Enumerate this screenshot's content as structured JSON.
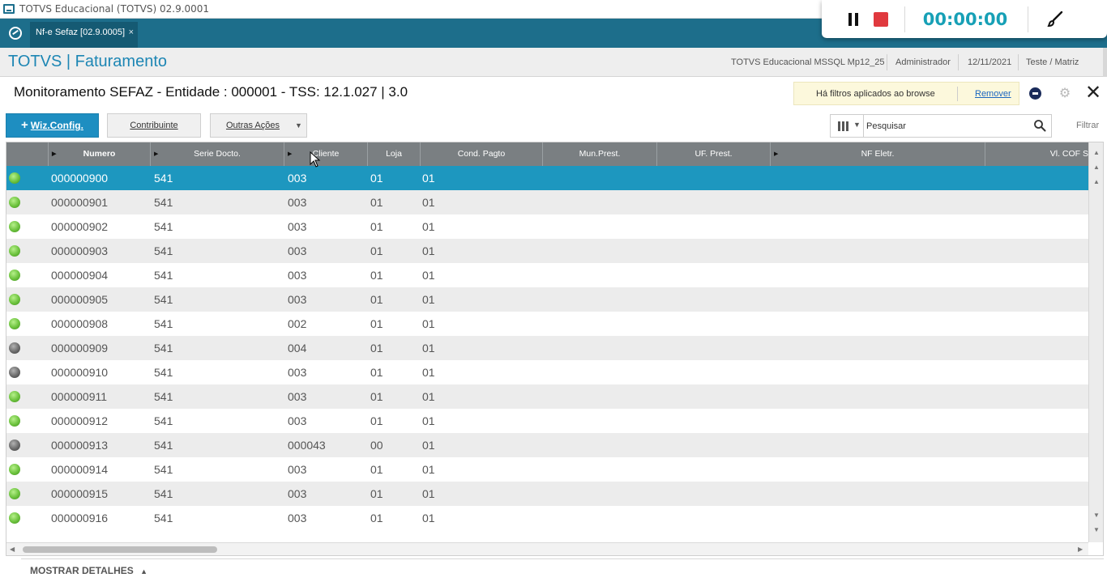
{
  "window": {
    "title": "TOTVS Educacional (TOTVS) 02.9.0001"
  },
  "recorder": {
    "time": "00:00:00",
    "icons": [
      "pause-icon",
      "stop-icon",
      "brush-icon"
    ],
    "accent": "#17a0b6"
  },
  "tabbar": {
    "tab_label": "Nf-e Sefaz [02.9.0005]",
    "close": "×",
    "color": "#1d6e8b"
  },
  "module": {
    "brand": "TOTVS | Faturamento",
    "environment": "TOTVS Educacional MSSQL Mp12_25",
    "user": "Administrador",
    "date": "12/11/2021",
    "branch": "Teste / Matriz"
  },
  "page": {
    "title": "Monitoramento SEFAZ - Entidade : 000001 - TSS: 12.1.027 | 3.0",
    "filter_notice": "Há filtros aplicados ao browse",
    "filter_remove": "Remover"
  },
  "toolbar": {
    "wiz_config": "Wiz.Config.",
    "contribuinte": "Contribuinte",
    "outras_acoes": "Outras Ações",
    "search_placeholder": "Pesquisar",
    "filtrar": "Filtrar"
  },
  "grid": {
    "headers": [
      "Numero",
      "Serie Docto.",
      "Cliente",
      "Loja",
      "Cond. Pagto",
      "Mun.Prest.",
      "UF. Prest.",
      "NF Eletr.",
      "Vl. COF S"
    ],
    "rows": [
      {
        "status": "green",
        "numero": "000000900",
        "serie": "541",
        "cliente": "003",
        "loja": "01",
        "cond": "01"
      },
      {
        "status": "green",
        "numero": "000000901",
        "serie": "541",
        "cliente": "003",
        "loja": "01",
        "cond": "01"
      },
      {
        "status": "green",
        "numero": "000000902",
        "serie": "541",
        "cliente": "003",
        "loja": "01",
        "cond": "01"
      },
      {
        "status": "green",
        "numero": "000000903",
        "serie": "541",
        "cliente": "003",
        "loja": "01",
        "cond": "01"
      },
      {
        "status": "green",
        "numero": "000000904",
        "serie": "541",
        "cliente": "003",
        "loja": "01",
        "cond": "01"
      },
      {
        "status": "green",
        "numero": "000000905",
        "serie": "541",
        "cliente": "003",
        "loja": "01",
        "cond": "01"
      },
      {
        "status": "green",
        "numero": "000000908",
        "serie": "541",
        "cliente": "002",
        "loja": "01",
        "cond": "01"
      },
      {
        "status": "gray",
        "numero": "000000909",
        "serie": "541",
        "cliente": "004",
        "loja": "01",
        "cond": "01"
      },
      {
        "status": "gray",
        "numero": "000000910",
        "serie": "541",
        "cliente": "003",
        "loja": "01",
        "cond": "01"
      },
      {
        "status": "green",
        "numero": "000000911",
        "serie": "541",
        "cliente": "003",
        "loja": "01",
        "cond": "01"
      },
      {
        "status": "green",
        "numero": "000000912",
        "serie": "541",
        "cliente": "003",
        "loja": "01",
        "cond": "01"
      },
      {
        "status": "gray",
        "numero": "000000913",
        "serie": "541",
        "cliente": "000043",
        "loja": "00",
        "cond": "01"
      },
      {
        "status": "green",
        "numero": "000000914",
        "serie": "541",
        "cliente": "003",
        "loja": "01",
        "cond": "01"
      },
      {
        "status": "green",
        "numero": "000000915",
        "serie": "541",
        "cliente": "003",
        "loja": "01",
        "cond": "01"
      },
      {
        "status": "green",
        "numero": "000000916",
        "serie": "541",
        "cliente": "003",
        "loja": "01",
        "cond": "01"
      }
    ],
    "selected_index": 0,
    "selection_color": "#1d97bf"
  },
  "footer": {
    "details_label": "MOSTRAR DETALHES",
    "details_arrow": "▲"
  }
}
